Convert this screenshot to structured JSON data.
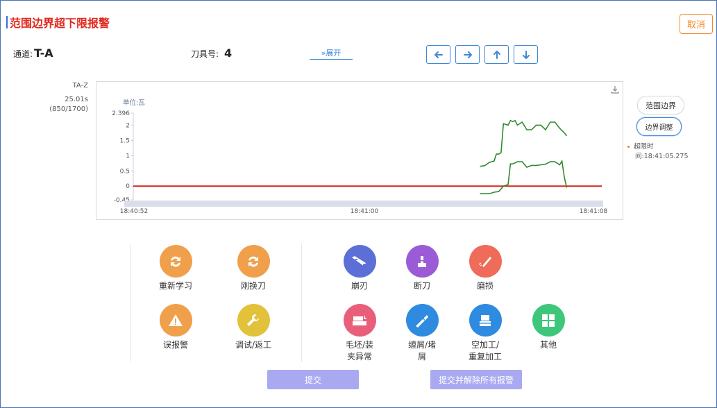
{
  "header": {
    "title": "范围边界超下限报警",
    "cancel_label": "取消"
  },
  "info": {
    "channel_label": "通道:",
    "channel_value": "T-A",
    "tool_label": "刀具号:",
    "tool_value": "4",
    "expand_label": "»展开"
  },
  "side": {
    "channel_name": "TA-Z",
    "time": "25.01s",
    "progress": "(850/1700)"
  },
  "chart_panel": {
    "range_button": "范围边界",
    "adjust_button": "边界调整",
    "overtime_label": "超限时",
    "overtime_value": "间:18:41:05.275"
  },
  "chart_data": {
    "type": "line",
    "ylabel": "单位:瓦",
    "ylim": [
      -0.45,
      2.396
    ],
    "y_ticks": [
      "2.396",
      "2",
      "1.5",
      "1",
      "0.5",
      "0",
      "-0.45"
    ],
    "x_ticks": [
      "18:40:52",
      "18:41:00",
      "18:41:08"
    ],
    "colors": {
      "upper": "#2f8a2f",
      "lower": "#2f8a2f",
      "limit": "#d9251c"
    },
    "series": [
      {
        "key": "upper",
        "x": [
          0.74,
          0.75,
          0.76,
          0.77,
          0.775,
          0.78,
          0.785,
          0.79,
          0.8,
          0.805,
          0.81,
          0.815,
          0.82,
          0.83,
          0.84,
          0.85,
          0.86,
          0.87,
          0.88,
          0.89,
          0.9,
          0.91,
          0.92,
          0.925
        ],
        "y": [
          0.65,
          0.67,
          0.78,
          0.82,
          1.05,
          1.05,
          1.1,
          2.05,
          2.0,
          2.15,
          2.12,
          2.15,
          2.0,
          2.1,
          1.85,
          1.85,
          2.0,
          2.0,
          1.85,
          2.1,
          2.1,
          1.9,
          1.75,
          1.65
        ]
      },
      {
        "key": "lower",
        "x": [
          0.74,
          0.76,
          0.77,
          0.78,
          0.79,
          0.8,
          0.805,
          0.81,
          0.82,
          0.83,
          0.84,
          0.85,
          0.86,
          0.87,
          0.88,
          0.89,
          0.9,
          0.91,
          0.915,
          0.92,
          0.925
        ],
        "y": [
          -0.25,
          -0.25,
          -0.2,
          -0.18,
          0.0,
          0.05,
          0.73,
          0.73,
          0.8,
          0.8,
          0.62,
          0.68,
          0.68,
          0.7,
          0.72,
          0.8,
          0.8,
          0.7,
          0.82,
          0.3,
          -0.05
        ]
      }
    ],
    "limit_value": 0
  },
  "options": [
    {
      "key": "relearn",
      "label": "重新学习",
      "color": "#f0a04b",
      "icon": "refresh-icon"
    },
    {
      "key": "newtool",
      "label": "刚换刀",
      "color": "#f0a04b",
      "icon": "refresh-icon"
    },
    {
      "key": "false_alarm",
      "label": "误报警",
      "color": "#f0a04b",
      "icon": "warning-icon"
    },
    {
      "key": "debug",
      "label": "调试/返工",
      "color": "#e3c23b",
      "icon": "wrench-icon"
    },
    {
      "key": "chipped",
      "label": "崩刃",
      "color": "#5b6fd6",
      "icon": "chipped-tool-icon"
    },
    {
      "key": "broken",
      "label": "断刀",
      "color": "#9b5bd6",
      "icon": "broken-tool-icon"
    },
    {
      "key": "wear",
      "label": "磨损",
      "color": "#ef6b5a",
      "icon": "wear-tool-icon"
    },
    {
      "key": "blank",
      "label": "毛坯/装\n夹异常",
      "color": "#e95f7a",
      "icon": "blank-clamp-icon"
    },
    {
      "key": "chip",
      "label": "缠屑/堵\n屑",
      "color": "#2f8be0",
      "icon": "chip-tangle-icon"
    },
    {
      "key": "empty",
      "label": "空加工/\n重复加工",
      "color": "#2f8be0",
      "icon": "empty-process-icon"
    },
    {
      "key": "other",
      "label": "其他",
      "color": "#3ec77a",
      "icon": "grid-icon"
    }
  ],
  "actions": {
    "submit": "提交",
    "submit_clear": "提交并解除所有报警"
  }
}
